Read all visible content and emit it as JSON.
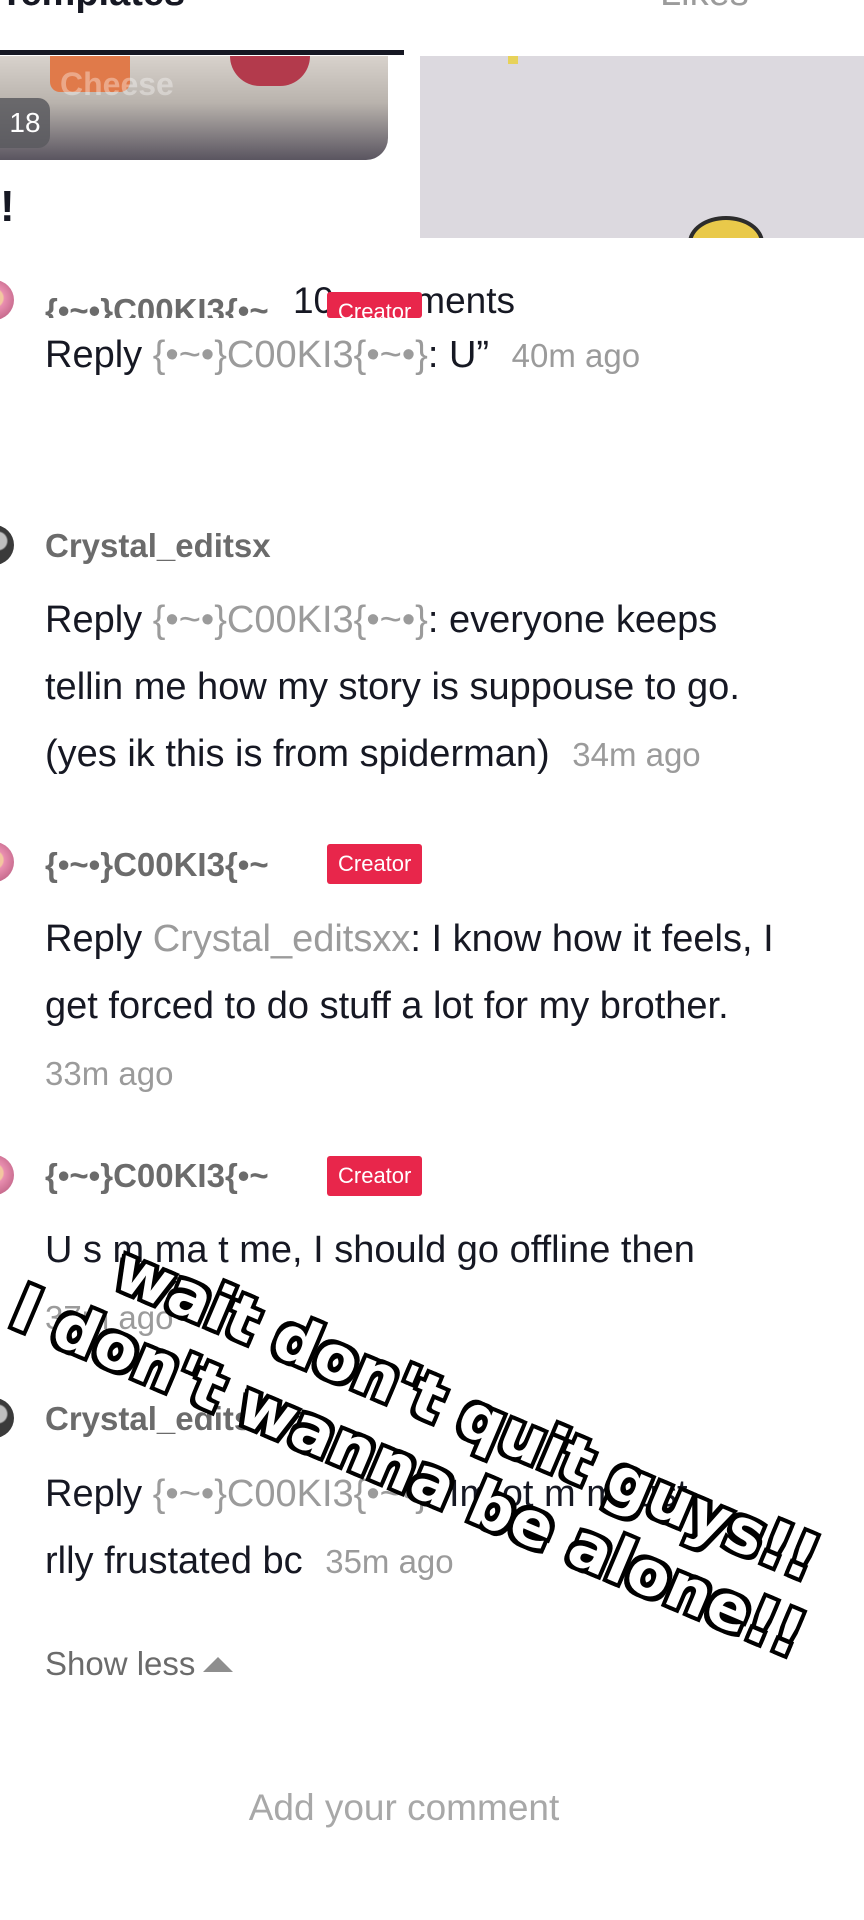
{
  "header": {
    "tab_left_label": "Templates",
    "tab_right_label": "Likes"
  },
  "thumbnails": {
    "count_badge": "18",
    "watermark": "Cheese",
    "exclaim": "!"
  },
  "comments_panel": {
    "title": "10 comments",
    "comments": [
      {
        "username": "{•~•}C00KI3{•~",
        "badge": "Creator",
        "reply_word": "Reply",
        "mention": "{•~•}C00KI3{•~•}",
        "body": ": U”",
        "time": "40m ago"
      },
      {
        "username": "Crystal_editsx",
        "reply_word": "Reply",
        "mention": "{•~•}C00KI3{•~•}",
        "body_line1": ": everyone keeps",
        "body_line2": "tellin me how my story is suppouse to go.",
        "body_line3": "(yes ik this is from spiderman)",
        "time": "34m ago"
      },
      {
        "username": "{•~•}C00KI3{•~",
        "badge": "Creator",
        "reply_word": "Reply",
        "mention": "Crystal_editsxx",
        "body_line1": ": I know how it feels, I",
        "body_line2": "get forced to do stuff a lot for my brother.",
        "time": "33m ago"
      },
      {
        "username": "{•~•}C00KI3{•~",
        "badge": "Creator",
        "body": "U s  m ma   t me, I should go offline then",
        "time": "37m ago"
      },
      {
        "username": "Crystal_editsx",
        "reply_word": "Reply",
        "mention": "{•~•}C00KI3{•~•}",
        "body_line1": ": Im  ot m    m just",
        "body_line2": "rlly frustated bc",
        "time": "35m ago"
      }
    ],
    "show_less": "Show less",
    "add_comment_placeholder": "Add your comment"
  },
  "overlay_text": {
    "line1": "wait don't quit guys!!",
    "line2": "I don't wanna be alone!!"
  },
  "colors": {
    "creator_badge": "#e8264b",
    "mention": "#9b9b9b",
    "text": "#161823"
  }
}
